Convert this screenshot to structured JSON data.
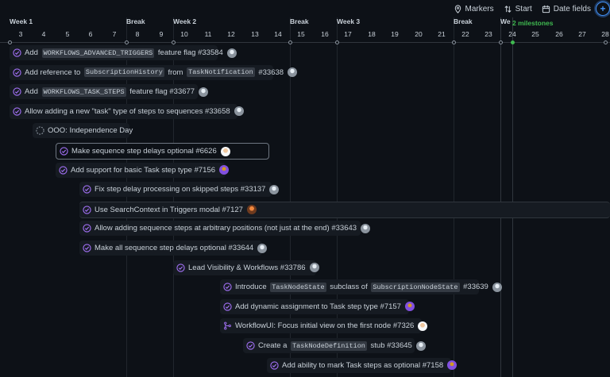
{
  "toolbar": {
    "markers": "Markers",
    "start": "Start",
    "date_fields": "Date fields"
  },
  "weeks": [
    "Week 1",
    "Break",
    "Week 2",
    "Break",
    "Week 3",
    "Break",
    "We"
  ],
  "days": [
    "3",
    "4",
    "5",
    "6",
    "7",
    "8",
    "9",
    "10",
    "11",
    "12",
    "13",
    "14",
    "15",
    "16",
    "17",
    "18",
    "19",
    "20",
    "21",
    "22",
    "23",
    "24",
    "25",
    "26",
    "27",
    "28"
  ],
  "milestone": "2 milestones",
  "items": [
    {
      "status": "done",
      "pre": "Add ",
      "code": "WORKFLOWS_ADVANCED_TRIGGERS",
      "post": " feature flag #33584"
    },
    {
      "status": "done",
      "pre": "Add reference to ",
      "code": "SubscriptionHistory",
      "mid": " from ",
      "code2": "TaskNotification",
      "post": " #33638"
    },
    {
      "status": "done",
      "pre": "Add ",
      "code": "WORKFLOWS_TASK_STEPS",
      "post": " feature flag #33677"
    },
    {
      "status": "done",
      "pre": "Allow adding a new \"task\" type of steps to sequences #33658"
    },
    {
      "status": "draft",
      "pre": "OOO: Independence Day"
    },
    {
      "status": "done",
      "pre": "Make sequence step delays optional #6626"
    },
    {
      "status": "done",
      "pre": "Add support for basic Task step type #7156"
    },
    {
      "status": "done",
      "pre": "Fix step delay processing on skipped steps #33137"
    },
    {
      "status": "done",
      "pre": "Use SearchContext in Triggers modal #7127"
    },
    {
      "status": "done",
      "pre": "Allow adding sequence steps at arbitrary positions (not just at the end) #33643"
    },
    {
      "status": "done",
      "pre": "Make all sequence step delays optional #33644"
    },
    {
      "status": "done",
      "pre": "Lead Visibility & Workflows #33786"
    },
    {
      "status": "done",
      "pre": "Introduce ",
      "code": "TaskNodeState",
      "mid": " subclass of ",
      "code2": "SubscriptionNodeState",
      "post": " #33639"
    },
    {
      "status": "done",
      "pre": "Add dynamic assignment to Task step type #7157"
    },
    {
      "status": "pr",
      "pre": "WorkflowUI: Focus initial view on the first node #7326"
    },
    {
      "status": "done",
      "pre": "Create a ",
      "code": "TaskNodeDefinition",
      "post": " stub #33645"
    },
    {
      "status": "done",
      "pre": "Add ability to mark Task steps as optional #7158"
    }
  ]
}
